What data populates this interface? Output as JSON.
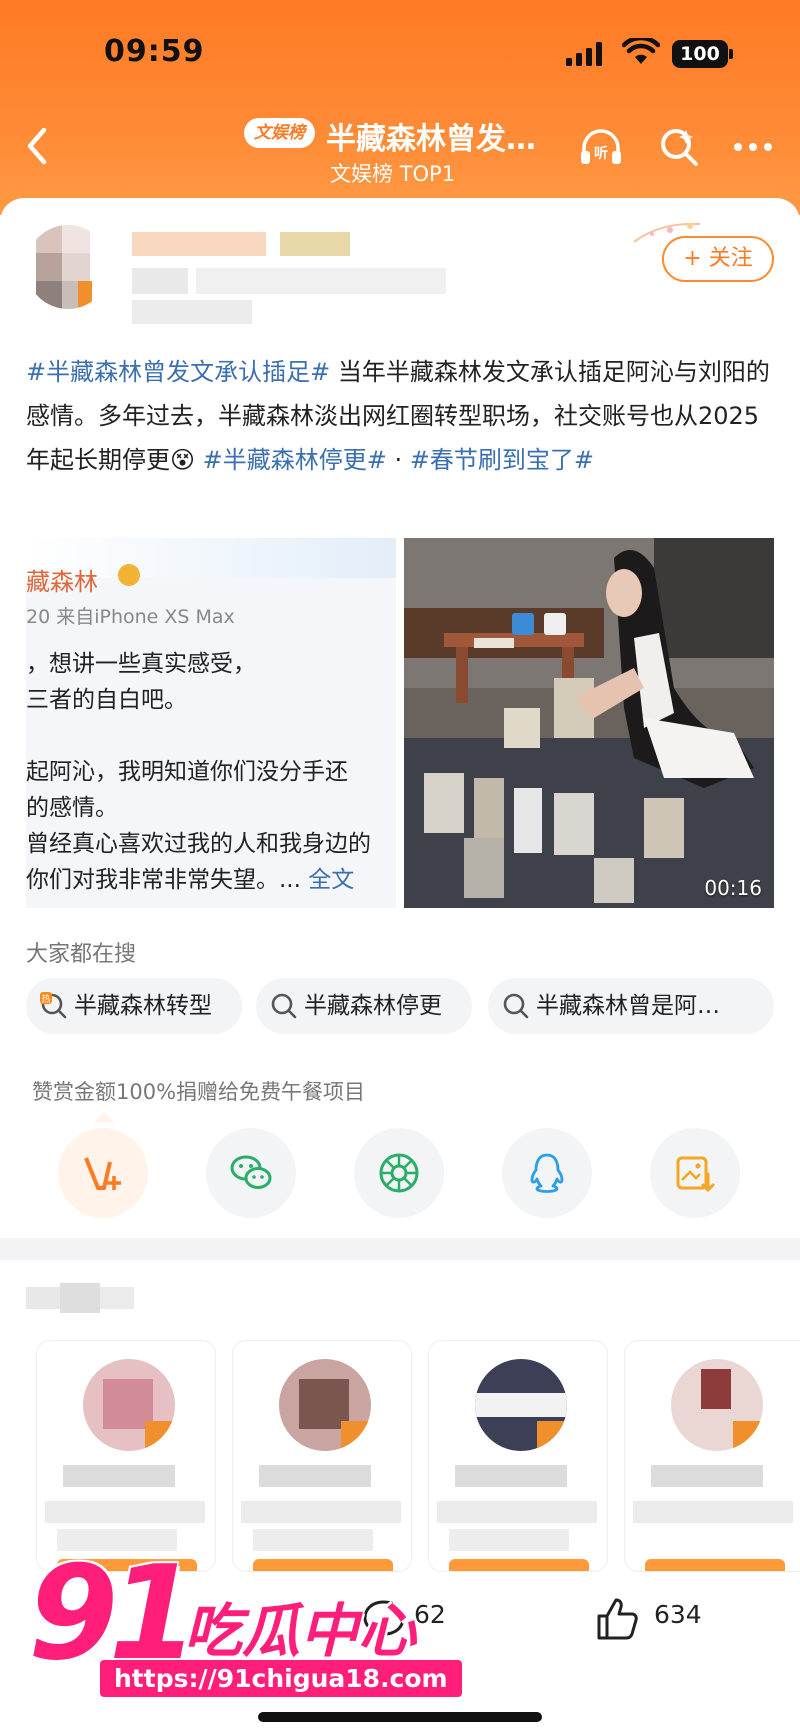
{
  "status": {
    "time": "09:59",
    "battery": "100"
  },
  "nav": {
    "badge": "文娱榜",
    "title": "半藏森林曾发…",
    "subtitle": "文娱榜 TOP1"
  },
  "post": {
    "follow_label": "+ 关注",
    "text_parts": [
      {
        "t": "#半藏森林曾发文承认插足#",
        "tag": true
      },
      {
        "t": " 当年半藏森林发文承认插足阿沁与刘阳的感情。多年过去，半藏森林淡出网红圈转型职场，社交账号也从2025年起长期停更😵 ",
        "tag": false
      },
      {
        "t": "#半藏森林停更#",
        "tag": true
      },
      {
        "t": " · ",
        "tag": false
      },
      {
        "t": "#春节刷到宝了#",
        "tag": true
      }
    ],
    "screenshot": {
      "name": "藏森林",
      "source": "20  来自iPhone XS Max",
      "lines": [
        "，想讲一些真实感受，",
        "三者的自白吧。",
        "",
        "起阿沁，我明知道你们没分手还",
        "的感情。",
        "曾经真心喜欢过我的人和我身边的",
        "你们对我非常非常失望。..."
      ],
      "more_link": "全文"
    },
    "video_duration": "00:16"
  },
  "search": {
    "title": "大家都在搜",
    "chips": [
      "半藏森林转型",
      "半藏森林停更",
      "半藏森林曾是阿…"
    ]
  },
  "donate_text": "赞赏金额100%捐赠给免费午餐项目",
  "stats": {
    "comments": "62",
    "likes": "634"
  },
  "watermark": {
    "brand_number": "91",
    "brand_name": "吃瓜中心",
    "url": "https://91chigua18.com"
  },
  "colors": {
    "accent": "#ff7a26",
    "tag": "#3b6fb0",
    "watermark": "#ff1e7a"
  }
}
